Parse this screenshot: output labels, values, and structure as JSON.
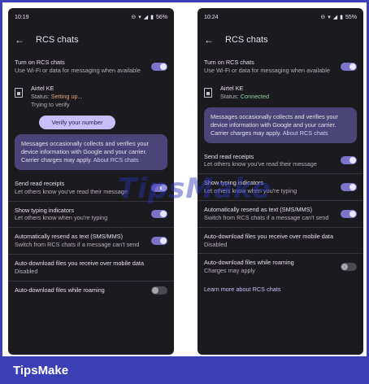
{
  "left": {
    "time": "10:19",
    "battery": "56%",
    "title": "RCS chats",
    "rcs_title": "Turn on RCS chats",
    "rcs_sub": "Use Wi-Fi or data for messaging when available",
    "sim_name": "Airtel KE",
    "status_label": "Status:",
    "status_value": "Setting up...",
    "trying": "Trying to verify",
    "verify_button": "Verify your number",
    "info_text": "Messages occasionally collects and verifies your device information with Google and your carrier. Carrier charges may apply.",
    "info_link": "About RCS chats",
    "read_title": "Send read receipts",
    "read_sub": "Let others know you've read their message",
    "typing_title": "Show typing indicators",
    "typing_sub": "Let others know when you're typing",
    "resend_title": "Automatically resend as text (SMS/MMS)",
    "resend_sub": "Switch from RCS chats if a message can't send",
    "mobile_title": "Auto-download files you receive over mobile data",
    "mobile_sub": "Disabled",
    "roaming_title": "Auto-download files while roaming"
  },
  "right": {
    "time": "10:24",
    "battery": "55%",
    "title": "RCS chats",
    "rcs_title": "Turn on RCS chats",
    "rcs_sub": "Use Wi-Fi or data for messaging when available",
    "sim_name": "Airtel KE",
    "status_label": "Status:",
    "status_value": "Connected",
    "info_text": "Messages occasionally collects and verifies your device information with Google and your carrier. Carrier charges may apply.",
    "info_link": "About RCS chats",
    "read_title": "Send read receipts",
    "read_sub": "Let others know you've read their message",
    "typing_title": "Show typing indicators",
    "typing_sub": "Let others know when you're typing",
    "resend_title": "Automatically resend as text (SMS/MMS)",
    "resend_sub": "Switch from RCS chats if a message can't send",
    "mobile_title": "Auto-download files you receive over mobile data",
    "mobile_sub": "Disabled",
    "roaming_title": "Auto-download files while roaming",
    "roaming_sub": "Charges may apply",
    "learn_more": "Learn more about RCS chats"
  },
  "watermark": "TipsMake",
  "brand": "TipsMake",
  "colors": {
    "accent": "#7b74c8",
    "card": "#4a4479",
    "background": "#1b1a1f",
    "brand_bar": "#3a3fb6"
  }
}
